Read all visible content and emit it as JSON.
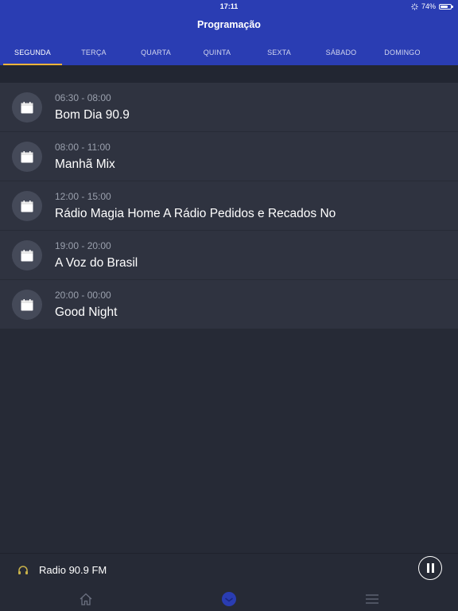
{
  "status_bar": {
    "time": "17:11",
    "battery": "74%",
    "battery_level": 0.74
  },
  "header": {
    "title": "Programação"
  },
  "tabs": [
    {
      "label": "SEGUNDA",
      "active": true
    },
    {
      "label": "TERÇA",
      "active": false
    },
    {
      "label": "QUARTA",
      "active": false
    },
    {
      "label": "QUINTA",
      "active": false
    },
    {
      "label": "SEXTA",
      "active": false
    },
    {
      "label": "SÁBADO",
      "active": false
    },
    {
      "label": "DOMINGO",
      "active": false
    }
  ],
  "schedule": [
    {
      "time": "06:30 - 08:00",
      "title": "Bom Dia 90.9",
      "icon": "calendar-icon"
    },
    {
      "time": "08:00 - 11:00",
      "title": "Manhã Mix",
      "icon": "calendar-icon"
    },
    {
      "time": "12:00 - 15:00",
      "title": "Rádio Magia Home A Rádio Pedidos e Recados No",
      "icon": "calendar-icon"
    },
    {
      "time": "19:00 - 20:00",
      "title": "A Voz do Brasil",
      "icon": "calendar-icon"
    },
    {
      "time": "20:00 - 00:00",
      "title": "Good Night",
      "icon": "calendar-icon"
    }
  ],
  "player": {
    "station_name": "Radio 90.9 FM",
    "icon": "headphones-icon",
    "control_icon": "pause-icon"
  },
  "bottom_nav": [
    {
      "icon": "home-icon",
      "active": false
    },
    {
      "icon": "schedule-icon",
      "active": true
    },
    {
      "icon": "menu-icon",
      "active": false
    }
  ],
  "colors": {
    "header": "#2a3db3",
    "accent": "#f3b43b",
    "background": "#262a36",
    "row": "#2f3340"
  }
}
